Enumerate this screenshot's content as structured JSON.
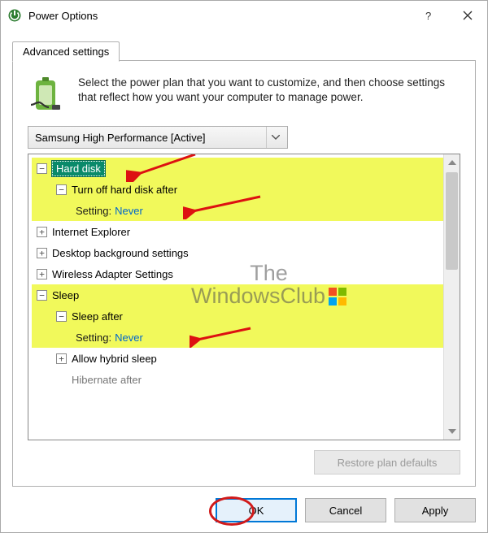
{
  "window": {
    "title": "Power Options"
  },
  "tab": {
    "label": "Advanced settings"
  },
  "intro": "Select the power plan that you want to customize, and then choose settings that reflect how you want your computer to manage power.",
  "plan_selected": "Samsung High Performance [Active]",
  "tree": {
    "hard_disk": "Hard disk",
    "turn_off_hdd": "Turn off hard disk after",
    "hdd_setting_label": "Setting:",
    "hdd_setting_value": "Never",
    "internet_explorer": "Internet Explorer",
    "desktop_bg": "Desktop background settings",
    "wireless": "Wireless Adapter Settings",
    "sleep": "Sleep",
    "sleep_after": "Sleep after",
    "sleep_setting_label": "Setting:",
    "sleep_setting_value": "Never",
    "hybrid_sleep": "Allow hybrid sleep",
    "hibernate_after": "Hibernate after"
  },
  "restore_label": "Restore plan defaults",
  "buttons": {
    "ok": "OK",
    "cancel": "Cancel",
    "apply": "Apply"
  },
  "watermark_line1": "The",
  "watermark_line2": "WindowsClub"
}
